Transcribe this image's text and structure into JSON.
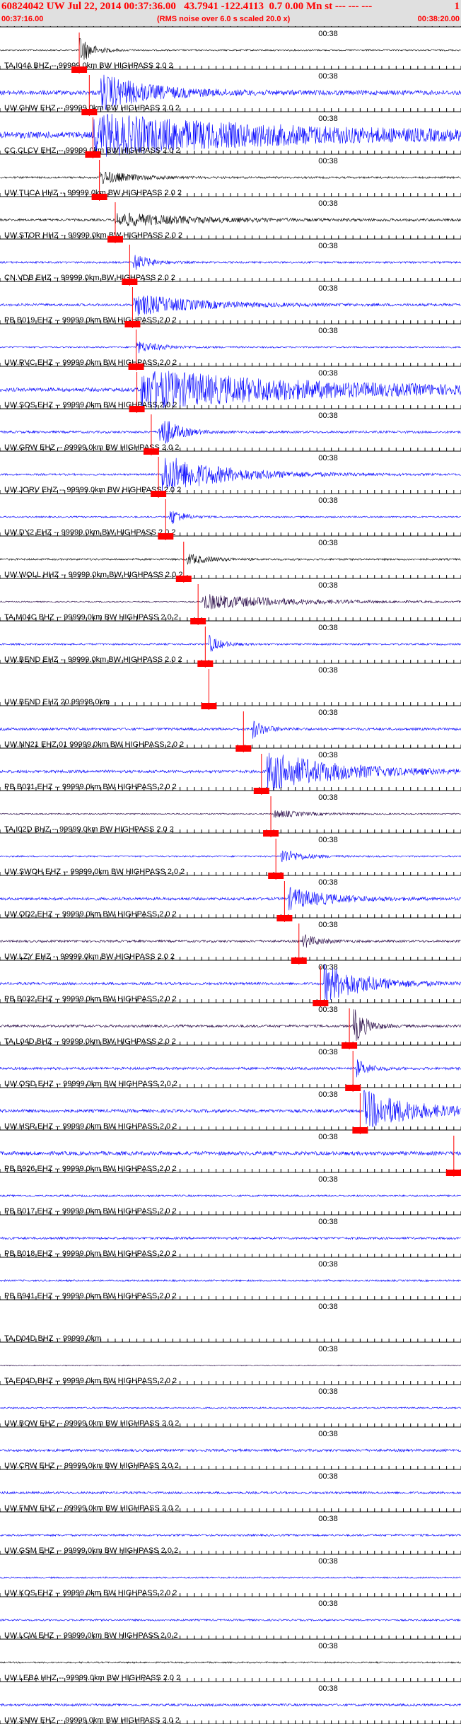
{
  "header": {
    "event_id": "60824042",
    "network": "UW",
    "datetime": "Jul 22, 2014 00:37:36.00",
    "location": "43.7941 -122.4113",
    "depth_mag": "0.7 0.00 Mn st",
    "dashes": "--- --- ---",
    "page": "1",
    "start_time": "00:37:16.00",
    "note": "(RMS noise over 6.0 s scaled 20.0 x)",
    "end_time": "00:38:20.00"
  },
  "colors": {
    "blue": "#0000ff",
    "black": "#000000",
    "purple": "#200040",
    "red": "#ff0000",
    "accent": "#ff0000"
  },
  "chart_data": {
    "type": "seismogram",
    "title": "60824042 UW Jul 22, 2014 00:37:36.00 43.7941 -122.4113 0.7 0.00 Mn st",
    "time_start": "00:37:16.00",
    "time_end": "00:38:20.00",
    "minute_tick_label": "00:38",
    "duration_s": 64,
    "minute_mark_s": 44,
    "traces": [
      {
        "label": "TA.I04A BHZ -- 99999.0km BW HIGHPASS 2.0 2",
        "color": "black",
        "pick": 11.0,
        "burst_s": 11.0,
        "burst_amp": 0.8,
        "burst_len": 3.0,
        "noise": 0.12
      },
      {
        "label": "UW.GHW EHZ -- 99999.0km BW HIGHPASS 2.0 2",
        "color": "blue",
        "pick": 12.4,
        "burst_s": 14.0,
        "burst_amp": 0.9,
        "burst_len": 12.0,
        "noise": 0.35
      },
      {
        "label": "CC.CLCV EHZ -- 99999.0km BW HIGHPASS 2.0 2",
        "color": "blue",
        "pick": 12.9,
        "burst_s": 13.0,
        "burst_amp": 1.0,
        "burst_len": 50.0,
        "noise": 0.5
      },
      {
        "label": "UW.TUCA HHZ -- 99999.0km BW HIGHPASS 2.0 2",
        "color": "black",
        "pick": 13.8,
        "burst_s": 13.8,
        "burst_amp": 0.35,
        "burst_len": 8.0,
        "noise": 0.15
      },
      {
        "label": "UW.STOR HHZ -- 99999.0km BW HIGHPASS 2.0 2",
        "color": "black",
        "pick": 16.0,
        "burst_s": 16.0,
        "burst_amp": 0.35,
        "burst_len": 20.0,
        "noise": 0.18
      },
      {
        "label": "CN.VDB EHZ -- 99999.0km BW HIGHPASS 2.0 2",
        "color": "blue",
        "pick": 18.0,
        "burst_s": 18.5,
        "burst_amp": 0.45,
        "burst_len": 4.0,
        "noise": 0.15
      },
      {
        "label": "PB.B019 EHZ -- 99999.0km BW HIGHPASS 2.0 2",
        "color": "blue",
        "pick": 18.4,
        "burst_s": 18.6,
        "burst_amp": 0.55,
        "burst_len": 15.0,
        "noise": 0.2
      },
      {
        "label": "UW.RVC EHZ -- 99999.0km BW HIGHPASS 2.0 2",
        "color": "blue",
        "pick": 18.9,
        "burst_s": 19.0,
        "burst_amp": 0.3,
        "burst_len": 6.0,
        "noise": 0.12
      },
      {
        "label": "UW.SOS EHZ -- 99999.0km BW HIGHPASS 2.0 2",
        "color": "blue",
        "pick": 19.0,
        "burst_s": 19.5,
        "burst_amp": 1.0,
        "burst_len": 45.0,
        "noise": 0.3
      },
      {
        "label": "UW.GPW EHZ -- 99999.0km BW HIGHPASS 2.0 2",
        "color": "blue",
        "pick": 21.0,
        "burst_s": 22.0,
        "burst_amp": 1.0,
        "burst_len": 4.0,
        "noise": 0.18
      },
      {
        "label": "UW.JORV EHZ -- 99999.0km BW HIGHPASS 2.0 2",
        "color": "blue",
        "pick": 22.0,
        "burst_s": 22.5,
        "burst_amp": 1.0,
        "burst_len": 15.0,
        "noise": 0.15
      },
      {
        "label": "UW.DY2 EHZ -- 99999.0km BW HIGHPASS 2.0 2",
        "color": "blue",
        "pick": 23.0,
        "burst_s": 23.5,
        "burst_amp": 0.5,
        "burst_len": 3.0,
        "noise": 0.12
      },
      {
        "label": "UW.WOLL HHZ -- 99999.0km BW HIGHPASS 2.0 2",
        "color": "black",
        "pick": 25.5,
        "burst_s": 26.0,
        "burst_amp": 0.3,
        "burst_len": 5.0,
        "noise": 0.15
      },
      {
        "label": "TA.M04C BHZ -- 99999.0km BW HIGHPASS 2.0 2",
        "color": "purple",
        "pick": 27.5,
        "burst_s": 28.0,
        "burst_amp": 0.4,
        "burst_len": 20.0,
        "noise": 0.1
      },
      {
        "label": "UW.BEND EHZ -- 99999.0km BW HIGHPASS 2.0 2",
        "color": "blue",
        "pick": 28.5,
        "burst_s": 29.0,
        "burst_amp": 0.45,
        "burst_len": 3.0,
        "noise": 0.14
      },
      {
        "label": "UW.BEND EHZ 20.99998.0km",
        "color": "blue",
        "pick": 29.0,
        "burst_s": 0,
        "burst_amp": 0,
        "burst_len": 0,
        "noise": 0.0
      },
      {
        "label": "UW.NN21 EHZ 01 99999.0km BW HIGHPASS 2.0 2",
        "color": "blue",
        "pick": 33.8,
        "burst_s": 35.0,
        "burst_amp": 0.5,
        "burst_len": 3.0,
        "noise": 0.2
      },
      {
        "label": "PB.B031 EHZ -- 99999.0km BW HIGHPASS 2.0 2",
        "color": "blue",
        "pick": 36.3,
        "burst_s": 37.0,
        "burst_amp": 1.0,
        "burst_len": 18.0,
        "noise": 0.22
      },
      {
        "label": "TA.I02D BHZ -- 99999.0km BW HIGHPASS 2.0 2",
        "color": "purple",
        "pick": 37.6,
        "burst_s": 38.0,
        "burst_amp": 0.2,
        "burst_len": 8.0,
        "noise": 0.1
      },
      {
        "label": "UW.SWOH EHZ -- 99999.0km BW HIGHPASS 2.0 2",
        "color": "blue",
        "pick": 38.3,
        "burst_s": 39.0,
        "burst_amp": 0.4,
        "burst_len": 5.0,
        "noise": 0.12
      },
      {
        "label": "UW.OD2 EHZ -- 99999.0km BW HIGHPASS 2.0 2",
        "color": "blue",
        "pick": 39.5,
        "burst_s": 40.0,
        "burst_amp": 0.55,
        "burst_len": 10.0,
        "noise": 0.22
      },
      {
        "label": "UW.LZY EHZ -- 99999.0km BW HIGHPASS 2.0 2",
        "color": "purple",
        "pick": 41.5,
        "burst_s": 42.0,
        "burst_amp": 0.35,
        "burst_len": 4.0,
        "noise": 0.18
      },
      {
        "label": "PB.B032 EHZ -- 99999.0km BW HIGHPASS 2.0 2",
        "color": "blue",
        "pick": 44.5,
        "burst_s": 45.0,
        "burst_amp": 1.0,
        "burst_len": 10.0,
        "noise": 0.2
      },
      {
        "label": "TA.L04D BHZ -- 99999.0km BW HIGHPASS 2.0 2",
        "color": "purple",
        "pick": 48.5,
        "burst_s": 49.0,
        "burst_amp": 1.0,
        "burst_len": 3.0,
        "noise": 0.2
      },
      {
        "label": "UW.OSD EHZ -- 99999.0km BW HIGHPASS 2.0 2",
        "color": "blue",
        "pick": 49.0,
        "burst_s": 49.5,
        "burst_amp": 0.45,
        "burst_len": 3.0,
        "noise": 0.2
      },
      {
        "label": "UW.HSR EHZ -- 99999.0km BW HIGHPASS 2.0 2",
        "color": "blue",
        "pick": 50.0,
        "burst_s": 50.5,
        "burst_amp": 1.0,
        "burst_len": 13.0,
        "noise": 0.25
      },
      {
        "label": "PB.B926 EHZ -- 99999.0km BW HIGHPASS 2.0 2",
        "color": "blue",
        "pick": 63.0,
        "burst_s": 0,
        "burst_amp": 0,
        "burst_len": 0,
        "noise": 0.3
      },
      {
        "label": "PB.B017 EHZ -- 99999.0km BW HIGHPASS 2.0 2",
        "color": "blue",
        "pick": null,
        "burst_s": 0,
        "burst_amp": 0,
        "burst_len": 0,
        "noise": 0.14
      },
      {
        "label": "PB.B018 EHZ -- 99999.0km BW HIGHPASS 2.0 2",
        "color": "blue",
        "pick": null,
        "burst_s": 0,
        "burst_amp": 0,
        "burst_len": 0,
        "noise": 0.18
      },
      {
        "label": "PB.B941 EHZ -- 99999.0km BW HIGHPASS 2.0 2",
        "color": "blue",
        "pick": null,
        "burst_s": 0,
        "burst_amp": 0,
        "burst_len": 0,
        "noise": 0.14
      },
      {
        "label": "TA.D04D BHZ -- 99999.0km",
        "color": "blue",
        "pick": null,
        "burst_s": 0,
        "burst_amp": 0,
        "burst_len": 0,
        "noise": 0.0
      },
      {
        "label": "TA.E04D BHZ -- 99999.0km BW HIGHPASS 2.0 2",
        "color": "purple",
        "pick": null,
        "burst_s": 0,
        "burst_amp": 0,
        "burst_len": 0,
        "noise": 0.08
      },
      {
        "label": "UW.BOW EHZ -- 99999.0km BW HIGHPASS 2.0 2",
        "color": "blue",
        "pick": null,
        "burst_s": 0,
        "burst_amp": 0,
        "burst_len": 0,
        "noise": 0.12
      },
      {
        "label": "UW.CPW EHZ -- 99999.0km BW HIGHPASS 2.0 2",
        "color": "blue",
        "pick": null,
        "burst_s": 0,
        "burst_amp": 0,
        "burst_len": 0,
        "noise": 0.2
      },
      {
        "label": "UW.FMW EHZ -- 99999.0km BW HIGHPASS 2.0 2",
        "color": "blue",
        "pick": null,
        "burst_s": 0,
        "burst_amp": 0,
        "burst_len": 0,
        "noise": 0.18
      },
      {
        "label": "UW.GSM EHZ -- 99999.0km BW HIGHPASS 2.0 2",
        "color": "blue",
        "pick": null,
        "burst_s": 0,
        "burst_amp": 0,
        "burst_len": 0,
        "noise": 0.16
      },
      {
        "label": "UW.KOS EHZ -- 99999.0km BW HIGHPASS 2.0 2",
        "color": "blue",
        "pick": null,
        "burst_s": 0,
        "burst_amp": 0,
        "burst_len": 0,
        "noise": 0.12
      },
      {
        "label": "UW.LCW EHZ -- 99999.0km BW HIGHPASS 2.0 2",
        "color": "blue",
        "pick": null,
        "burst_s": 0,
        "burst_amp": 0,
        "burst_len": 0,
        "noise": 0.14
      },
      {
        "label": "UW.LEBA HHZ -- 99999.0km BW HIGHPASS 2.0 2",
        "color": "black",
        "pick": null,
        "burst_s": 0,
        "burst_amp": 0,
        "burst_len": 0,
        "noise": 0.12
      },
      {
        "label": "UW.SMW EHZ -- 99999.0km BW HIGHPASS 2.0 2",
        "color": "blue",
        "pick": null,
        "burst_s": 0,
        "burst_amp": 0,
        "burst_len": 0,
        "noise": 0.18
      }
    ]
  }
}
